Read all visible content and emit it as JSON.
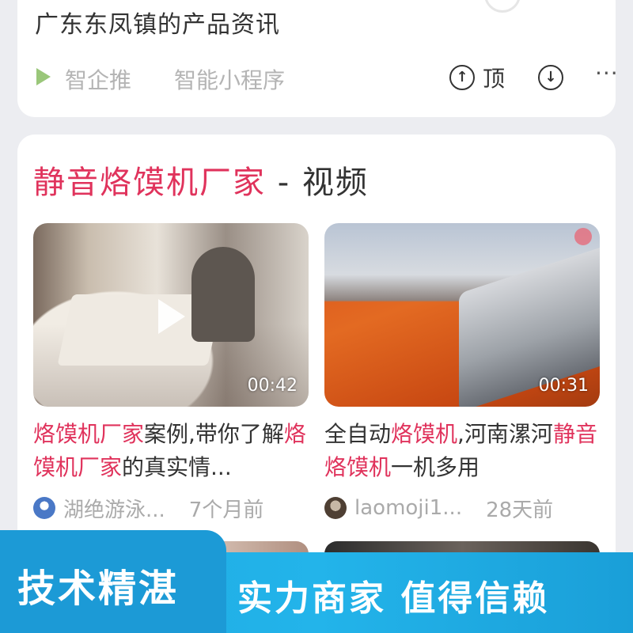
{
  "top_result": {
    "snippet": "广东东凤镇的产品资讯",
    "source_name": "智企推",
    "source_sub": "智能小程序",
    "top_label": "顶"
  },
  "video_section": {
    "title_highlight": "静音烙馍机厂家",
    "title_rest": " - 视频",
    "videos": [
      {
        "duration": "00:42",
        "title_parts": [
          {
            "text": "烙馍机厂家",
            "hl": true
          },
          {
            "text": "案例,带你了解",
            "hl": false
          },
          {
            "text": "烙馍机厂家",
            "hl": true
          },
          {
            "text": "的真实情...",
            "hl": false
          }
        ],
        "author": "湖绝游泳...",
        "time": "7个月前"
      },
      {
        "duration": "00:31",
        "title_parts": [
          {
            "text": "全自动",
            "hl": false
          },
          {
            "text": "烙馍机",
            "hl": true
          },
          {
            "text": ",河南漯河",
            "hl": false
          },
          {
            "text": "静音烙馍机",
            "hl": true
          },
          {
            "text": "一机多用",
            "hl": false
          }
        ],
        "author": "laomoji1...",
        "time": "28天前"
      }
    ]
  },
  "banner": {
    "tab_text": "技术精湛",
    "slogan": "实力商家  值得信赖"
  },
  "icons": {
    "source": "play-icon",
    "top": "up-arrow-circle-icon",
    "down": "down-arrow-circle-icon",
    "more": "more-icon"
  },
  "colors": {
    "highlight": "#e0335c",
    "banner": "#1da8e0"
  }
}
